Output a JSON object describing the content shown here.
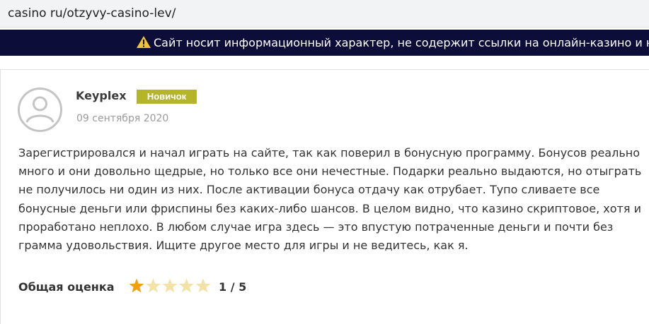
{
  "address_bar": {
    "url": "casino ru/otzyvy-casino-lev/"
  },
  "notice": {
    "text": "Сайт носит информационный характер, не содержит ссылки на онлайн-казино и не п"
  },
  "review": {
    "author": "Keyplex",
    "badge": "Новичок",
    "date": "09 сентября 2020",
    "lines": [
      "Зарегистрировался и начал играть на сайте, так как поверил в бонусную программу. Бонусов реально",
      "много и они довольно щедрые, но только все они нечестные. Подарки реально выдаются, но отыграть",
      "не получилось ни один из них. После активации бонуса отдачу как отрубает. Тупо сливаете все",
      "бонусные деньги или фриспины без каких-либо шансов. В целом видно, что казино скриптовое, хотя и",
      "проработано неплохо. В любом случае игра здесь — это впустую потраченные деньги и почти без",
      "грамма удовольствия. Ищите другое место для игры и не ведитесь, как я."
    ],
    "rating_label": "Общая оценка",
    "rating_value": 1,
    "rating_max": 5,
    "rating_text": "1 / 5"
  },
  "colors": {
    "notice_bg": "#0d0d3a",
    "badge_bg": "#b5b52a",
    "star_filled": "#f0a10a",
    "star_empty": "#f3e2a5"
  },
  "icons": {
    "warning": "warning-icon",
    "avatar": "user-avatar-icon",
    "star": "star-icon"
  }
}
